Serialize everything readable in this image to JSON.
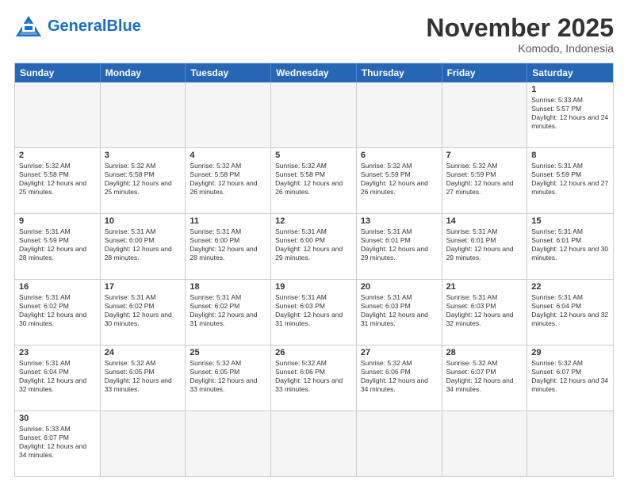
{
  "header": {
    "logo_general": "General",
    "logo_blue": "Blue",
    "month_title": "November 2025",
    "location": "Komodo, Indonesia"
  },
  "weekdays": [
    "Sunday",
    "Monday",
    "Tuesday",
    "Wednesday",
    "Thursday",
    "Friday",
    "Saturday"
  ],
  "rows": [
    [
      {
        "day": "",
        "text": ""
      },
      {
        "day": "",
        "text": ""
      },
      {
        "day": "",
        "text": ""
      },
      {
        "day": "",
        "text": ""
      },
      {
        "day": "",
        "text": ""
      },
      {
        "day": "",
        "text": ""
      },
      {
        "day": "1",
        "text": "Sunrise: 5:33 AM\nSunset: 5:57 PM\nDaylight: 12 hours and 24 minutes."
      }
    ],
    [
      {
        "day": "2",
        "text": "Sunrise: 5:32 AM\nSunset: 5:58 PM\nDaylight: 12 hours and 25 minutes."
      },
      {
        "day": "3",
        "text": "Sunrise: 5:32 AM\nSunset: 5:58 PM\nDaylight: 12 hours and 25 minutes."
      },
      {
        "day": "4",
        "text": "Sunrise: 5:32 AM\nSunset: 5:58 PM\nDaylight: 12 hours and 26 minutes."
      },
      {
        "day": "5",
        "text": "Sunrise: 5:32 AM\nSunset: 5:58 PM\nDaylight: 12 hours and 26 minutes."
      },
      {
        "day": "6",
        "text": "Sunrise: 5:32 AM\nSunset: 5:59 PM\nDaylight: 12 hours and 26 minutes."
      },
      {
        "day": "7",
        "text": "Sunrise: 5:32 AM\nSunset: 5:59 PM\nDaylight: 12 hours and 27 minutes."
      },
      {
        "day": "8",
        "text": "Sunrise: 5:31 AM\nSunset: 5:59 PM\nDaylight: 12 hours and 27 minutes."
      }
    ],
    [
      {
        "day": "9",
        "text": "Sunrise: 5:31 AM\nSunset: 5:59 PM\nDaylight: 12 hours and 28 minutes."
      },
      {
        "day": "10",
        "text": "Sunrise: 5:31 AM\nSunset: 6:00 PM\nDaylight: 12 hours and 28 minutes."
      },
      {
        "day": "11",
        "text": "Sunrise: 5:31 AM\nSunset: 6:00 PM\nDaylight: 12 hours and 28 minutes."
      },
      {
        "day": "12",
        "text": "Sunrise: 5:31 AM\nSunset: 6:00 PM\nDaylight: 12 hours and 29 minutes."
      },
      {
        "day": "13",
        "text": "Sunrise: 5:31 AM\nSunset: 6:01 PM\nDaylight: 12 hours and 29 minutes."
      },
      {
        "day": "14",
        "text": "Sunrise: 5:31 AM\nSunset: 6:01 PM\nDaylight: 12 hours and 29 minutes."
      },
      {
        "day": "15",
        "text": "Sunrise: 5:31 AM\nSunset: 6:01 PM\nDaylight: 12 hours and 30 minutes."
      }
    ],
    [
      {
        "day": "16",
        "text": "Sunrise: 5:31 AM\nSunset: 6:02 PM\nDaylight: 12 hours and 30 minutes."
      },
      {
        "day": "17",
        "text": "Sunrise: 5:31 AM\nSunset: 6:02 PM\nDaylight: 12 hours and 30 minutes."
      },
      {
        "day": "18",
        "text": "Sunrise: 5:31 AM\nSunset: 6:02 PM\nDaylight: 12 hours and 31 minutes."
      },
      {
        "day": "19",
        "text": "Sunrise: 5:31 AM\nSunset: 6:03 PM\nDaylight: 12 hours and 31 minutes."
      },
      {
        "day": "20",
        "text": "Sunrise: 5:31 AM\nSunset: 6:03 PM\nDaylight: 12 hours and 31 minutes."
      },
      {
        "day": "21",
        "text": "Sunrise: 5:31 AM\nSunset: 6:03 PM\nDaylight: 12 hours and 32 minutes."
      },
      {
        "day": "22",
        "text": "Sunrise: 5:31 AM\nSunset: 6:04 PM\nDaylight: 12 hours and 32 minutes."
      }
    ],
    [
      {
        "day": "23",
        "text": "Sunrise: 5:31 AM\nSunset: 6:04 PM\nDaylight: 12 hours and 32 minutes."
      },
      {
        "day": "24",
        "text": "Sunrise: 5:32 AM\nSunset: 6:05 PM\nDaylight: 12 hours and 33 minutes."
      },
      {
        "day": "25",
        "text": "Sunrise: 5:32 AM\nSunset: 6:05 PM\nDaylight: 12 hours and 33 minutes."
      },
      {
        "day": "26",
        "text": "Sunrise: 5:32 AM\nSunset: 6:06 PM\nDaylight: 12 hours and 33 minutes."
      },
      {
        "day": "27",
        "text": "Sunrise: 5:32 AM\nSunset: 6:06 PM\nDaylight: 12 hours and 34 minutes."
      },
      {
        "day": "28",
        "text": "Sunrise: 5:32 AM\nSunset: 6:07 PM\nDaylight: 12 hours and 34 minutes."
      },
      {
        "day": "29",
        "text": "Sunrise: 5:32 AM\nSunset: 6:07 PM\nDaylight: 12 hours and 34 minutes."
      }
    ],
    [
      {
        "day": "30",
        "text": "Sunrise: 5:33 AM\nSunset: 6:07 PM\nDaylight: 12 hours and 34 minutes."
      },
      {
        "day": "",
        "text": ""
      },
      {
        "day": "",
        "text": ""
      },
      {
        "day": "",
        "text": ""
      },
      {
        "day": "",
        "text": ""
      },
      {
        "day": "",
        "text": ""
      },
      {
        "day": "",
        "text": ""
      }
    ]
  ]
}
